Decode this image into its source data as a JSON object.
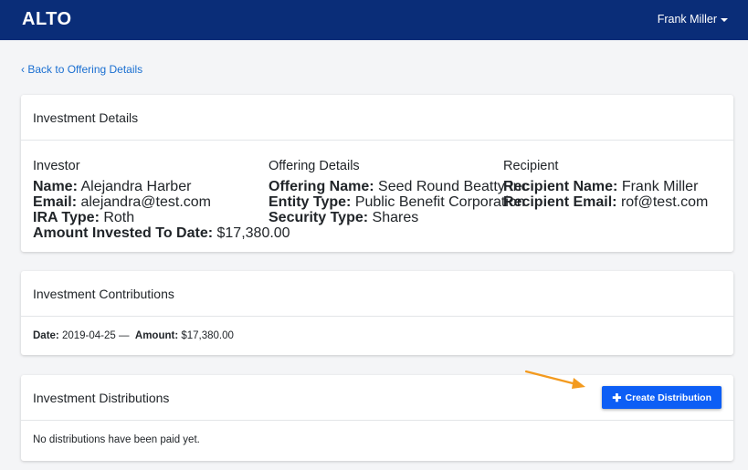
{
  "nav": {
    "logo": "ALTO",
    "user_name": "Frank Miller"
  },
  "back_link": "Back to Offering Details",
  "investment_details": {
    "title": "Investment Details",
    "investor": {
      "heading": "Investor",
      "rows": [
        {
          "label": "Name:",
          "value": "Alejandra Harber"
        },
        {
          "label": "Email:",
          "value": "alejandra@test.com"
        },
        {
          "label": "IRA Type:",
          "value": "Roth"
        },
        {
          "label": "Amount Invested To Date:",
          "value": "$17,380.00"
        }
      ]
    },
    "offering": {
      "heading": "Offering Details",
      "rows": [
        {
          "label": "Offering Name:",
          "value": "Seed Round Beatty Inc"
        },
        {
          "label": "Entity Type:",
          "value": "Public Benefit Corporation"
        },
        {
          "label": "Security Type:",
          "value": "Shares"
        }
      ]
    },
    "recipient": {
      "heading": "Recipient",
      "rows": [
        {
          "label": "Recipient Name:",
          "value": "Frank Miller"
        },
        {
          "label": "Recipient Email:",
          "value": "rof@test.com"
        }
      ]
    }
  },
  "contributions": {
    "title": "Investment Contributions",
    "date_label": "Date:",
    "date_value": "2019-04-25",
    "separator": "—",
    "amount_label": "Amount:",
    "amount_value": "$17,380.00"
  },
  "distributions": {
    "title": "Investment Distributions",
    "button_label": "Create Distribution",
    "empty_text": "No distributions have been paid yet."
  },
  "colors": {
    "navbar": "#0a2d78",
    "link": "#1a6fd1",
    "primary_button": "#0d5ef5",
    "annotation_arrow": "#f39a1e"
  },
  "icons": [
    "chevron-left-icon",
    "caret-down-icon",
    "plus-icon",
    "annotation-arrow-icon"
  ]
}
